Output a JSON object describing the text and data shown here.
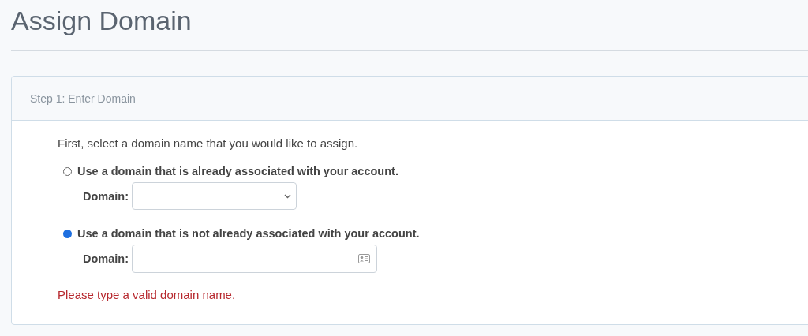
{
  "page_title": "Assign Domain",
  "panel": {
    "title": "Step 1: Enter Domain",
    "intro": "First, select a domain name that you would like to assign.",
    "options": [
      {
        "label": "Use a domain that is already associated with your account.",
        "selected": false,
        "field": {
          "kind": "select",
          "label": "Domain:"
        }
      },
      {
        "label": "Use a domain that is not already associated with your account.",
        "selected": true,
        "field": {
          "kind": "text",
          "label": "Domain:"
        }
      }
    ],
    "error": "Please type a valid domain name."
  }
}
